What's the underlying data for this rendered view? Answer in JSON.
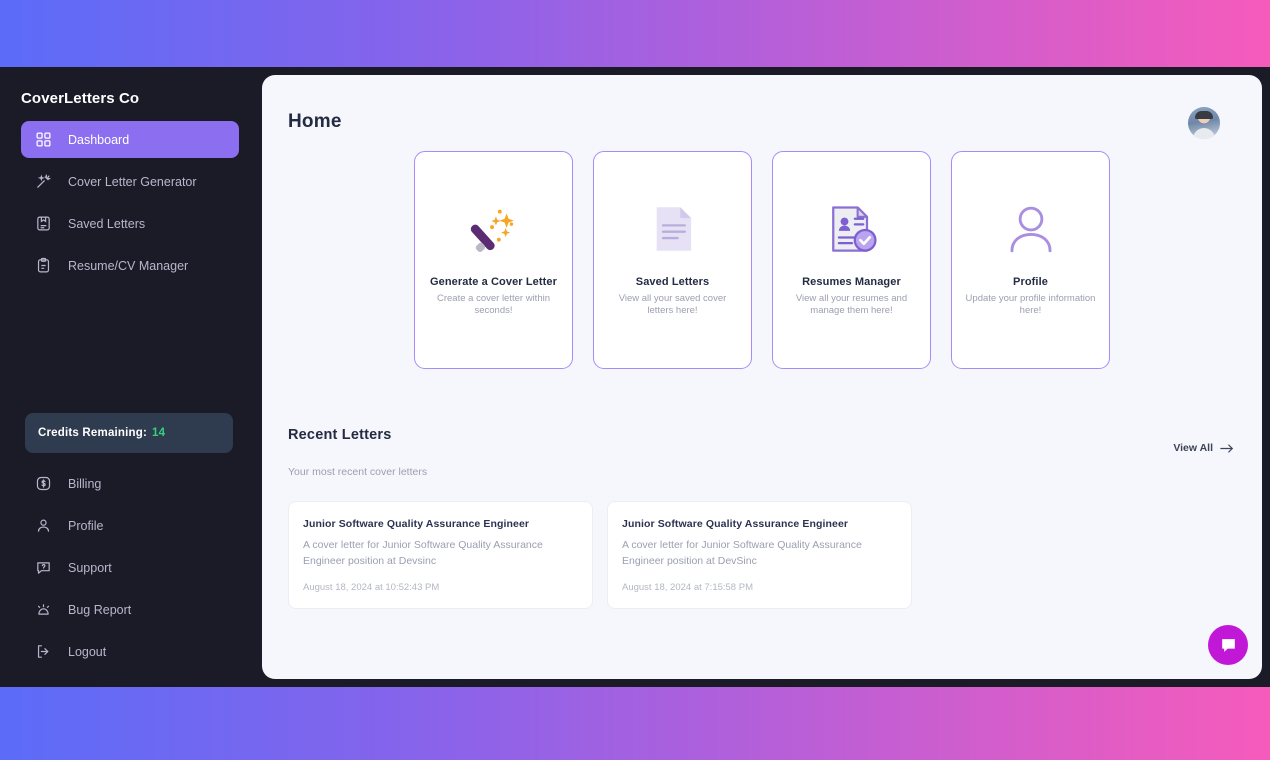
{
  "brand": "CoverLetters Co",
  "sidebar": {
    "nav_top": [
      {
        "label": "Dashboard",
        "icon": "grid-icon",
        "active": true
      },
      {
        "label": "Cover Letter Generator",
        "icon": "magic-wand-icon",
        "active": false
      },
      {
        "label": "Saved Letters",
        "icon": "save-document-icon",
        "active": false
      },
      {
        "label": "Resume/CV Manager",
        "icon": "clipboard-icon",
        "active": false
      }
    ],
    "credits": {
      "label": "Credits Remaining:",
      "value": "14",
      "value_color": "#35d07f"
    },
    "nav_bottom": [
      {
        "label": "Billing",
        "icon": "dollar-circle-icon"
      },
      {
        "label": "Profile",
        "icon": "user-icon"
      },
      {
        "label": "Support",
        "icon": "question-chat-icon"
      },
      {
        "label": "Bug Report",
        "icon": "alarm-icon"
      },
      {
        "label": "Logout",
        "icon": "logout-icon"
      }
    ]
  },
  "header": {
    "title": "Home",
    "avatar": "user-avatar"
  },
  "cards": [
    {
      "title": "Generate a Cover Letter",
      "desc": "Create a cover letter within seconds!",
      "icon": "magic-wand-illustration"
    },
    {
      "title": "Saved Letters",
      "desc": "View all your saved cover letters here!",
      "icon": "document-illustration"
    },
    {
      "title": "Resumes Manager",
      "desc": "View all your resumes and manage them here!",
      "icon": "resume-check-illustration"
    },
    {
      "title": "Profile",
      "desc": "Update your profile information here!",
      "icon": "person-illustration"
    }
  ],
  "recent": {
    "title": "Recent Letters",
    "subtitle": "Your most recent cover letters",
    "view_all": "View All",
    "view_all_icon": "arrow-right-icon",
    "letters": [
      {
        "title": "Junior Software Quality Assurance Engineer",
        "desc": "A cover letter for Junior Software Quality Assurance Engineer position at Devsinc",
        "date": "August 18, 2024 at 10:52:43 PM"
      },
      {
        "title": "Junior Software Quality Assurance Engineer",
        "desc": "A cover letter for Junior Software Quality Assurance Engineer position at DevSinc",
        "date": "August 18, 2024 at 7:15:58 PM"
      }
    ]
  },
  "chat": {
    "icon": "chat-bubble-icon",
    "color": "#c018d6"
  },
  "theme": {
    "page_gradient_from": "#5b6cf8",
    "page_gradient_to": "#f65bbb",
    "sidebar_bg": "#1b1b28",
    "panel_bg": "#f5f7fc",
    "accent": "#8c6ef0",
    "card_border": "#a78bfa"
  }
}
